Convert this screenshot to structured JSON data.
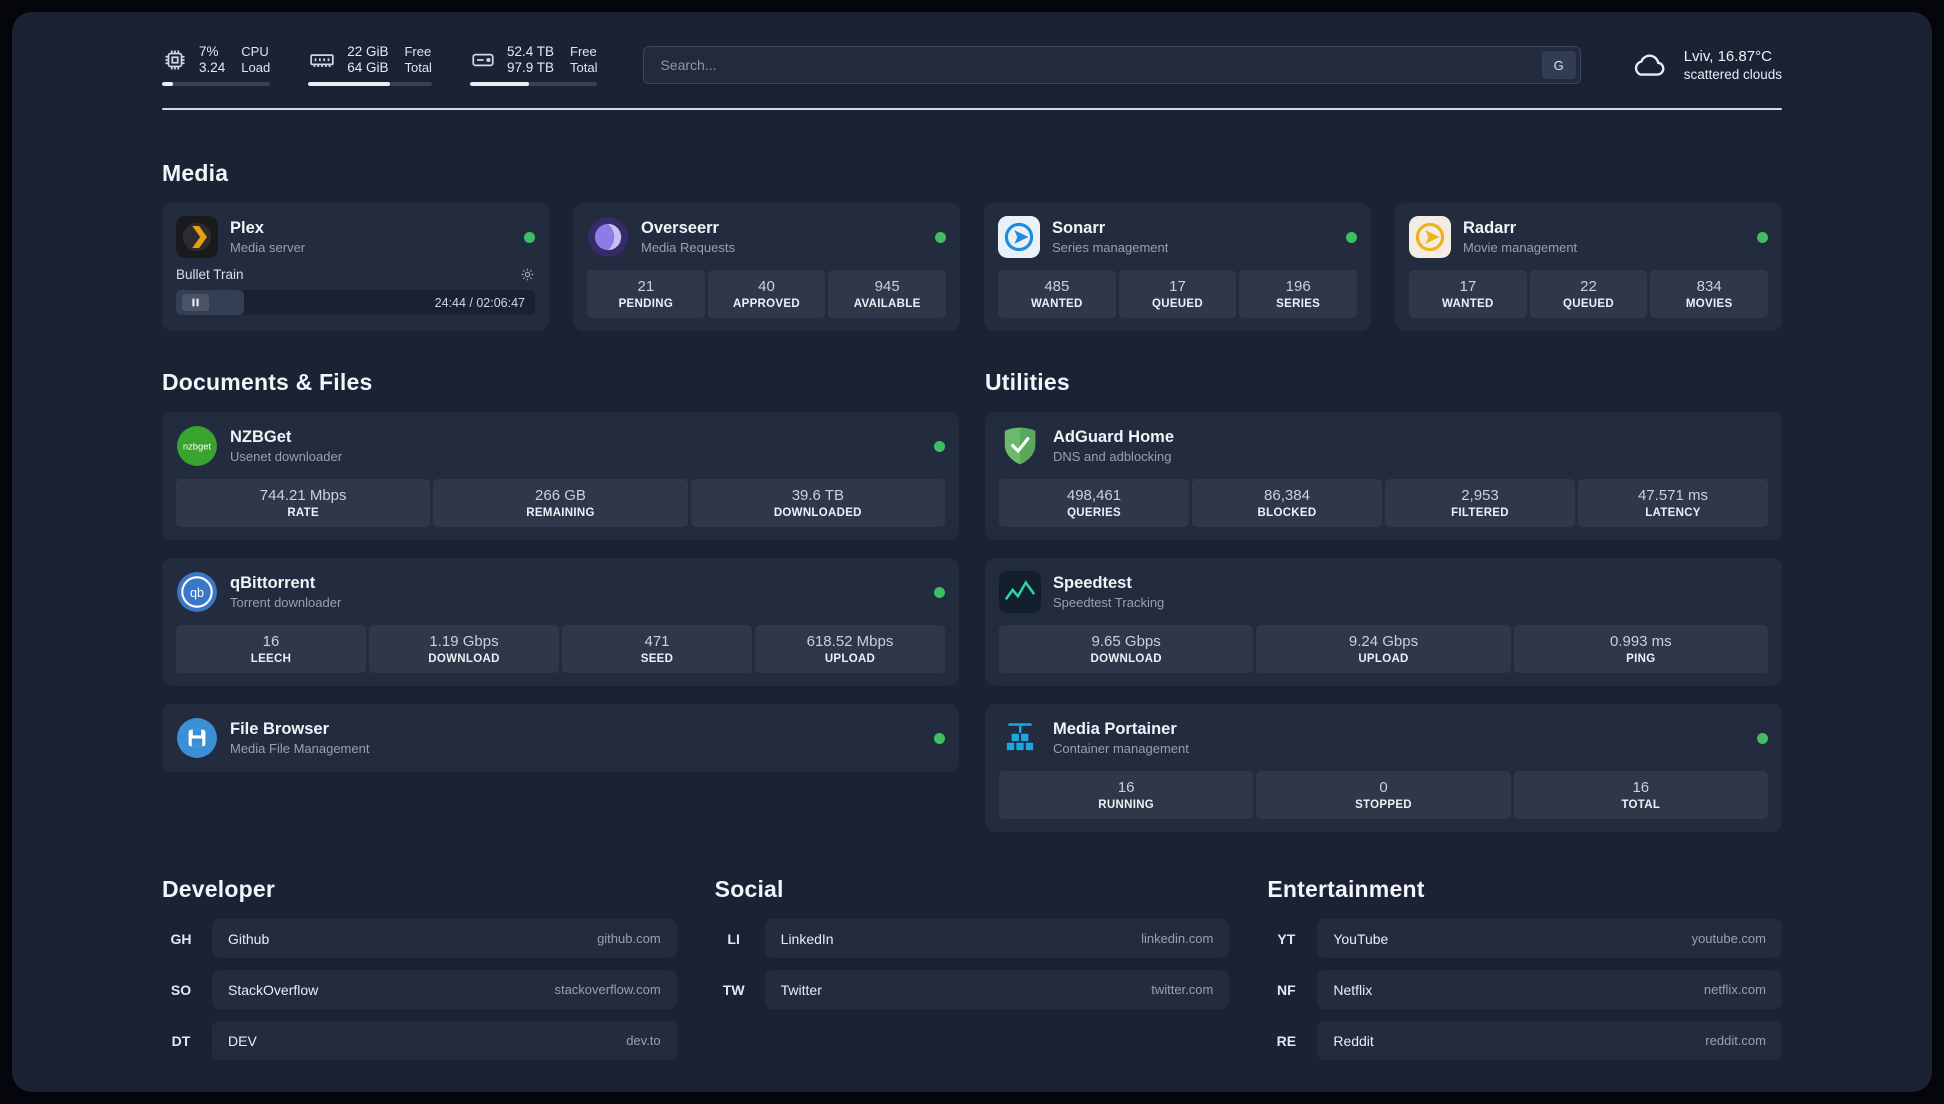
{
  "colors": {
    "status_green": "#3dbe63",
    "accent_bar": "#e9edf4"
  },
  "topbar": {
    "metrics": [
      {
        "id": "cpu",
        "icon": "cpu-icon",
        "v1": "7%",
        "l1": "CPU",
        "v2": "3.24",
        "l2": "Load",
        "progress": 10
      },
      {
        "id": "ram",
        "icon": "ram-icon",
        "v1": "22 GiB",
        "l1": "Free",
        "v2": "64 GiB",
        "l2": "Total",
        "progress": 66
      },
      {
        "id": "disk",
        "icon": "disk-icon",
        "v1": "52.4 TB",
        "l1": "Free",
        "v2": "97.9 TB",
        "l2": "Total",
        "progress": 46
      }
    ],
    "search": {
      "placeholder": "Search...",
      "button_label": "G"
    },
    "weather": {
      "icon": "cloud-icon",
      "location": "Lviv, 16.87°C",
      "condition": "scattered clouds"
    }
  },
  "sections": {
    "media": {
      "title": "Media",
      "apps": [
        {
          "name": "Plex",
          "subtitle": "Media server",
          "icon": "plex-icon",
          "online": true,
          "player": {
            "track": "Bullet Train",
            "time": "24:44 / 02:06:47",
            "progress": 19
          }
        },
        {
          "name": "Overseerr",
          "subtitle": "Media Requests",
          "icon": "overseerr-icon",
          "online": true,
          "stats": [
            {
              "value": "21",
              "label": "PENDING"
            },
            {
              "value": "40",
              "label": "APPROVED"
            },
            {
              "value": "945",
              "label": "AVAILABLE"
            }
          ]
        },
        {
          "name": "Sonarr",
          "subtitle": "Series management",
          "icon": "sonarr-icon",
          "online": true,
          "stats": [
            {
              "value": "485",
              "label": "WANTED"
            },
            {
              "value": "17",
              "label": "QUEUED"
            },
            {
              "value": "196",
              "label": "SERIES"
            }
          ]
        },
        {
          "name": "Radarr",
          "subtitle": "Movie management",
          "icon": "radarr-icon",
          "online": true,
          "stats": [
            {
              "value": "17",
              "label": "WANTED"
            },
            {
              "value": "22",
              "label": "QUEUED"
            },
            {
              "value": "834",
              "label": "MOVIES"
            }
          ]
        }
      ]
    },
    "documents": {
      "title": "Documents & Files",
      "apps": [
        {
          "name": "NZBGet",
          "subtitle": "Usenet downloader",
          "icon": "nzbget-icon",
          "online": true,
          "stats": [
            {
              "value": "744.21 Mbps",
              "label": "RATE"
            },
            {
              "value": "266 GB",
              "label": "REMAINING"
            },
            {
              "value": "39.6 TB",
              "label": "DOWNLOADED"
            }
          ]
        },
        {
          "name": "qBittorrent",
          "subtitle": "Torrent downloader",
          "icon": "qbittorrent-icon",
          "online": true,
          "stats": [
            {
              "value": "16",
              "label": "LEECH"
            },
            {
              "value": "1.19 Gbps",
              "label": "DOWNLOAD"
            },
            {
              "value": "471",
              "label": "SEED"
            },
            {
              "value": "618.52 Mbps",
              "label": "UPLOAD"
            }
          ]
        },
        {
          "name": "File Browser",
          "subtitle": "Media File Management",
          "icon": "filebrowser-icon",
          "online": true,
          "stats": []
        }
      ]
    },
    "utilities": {
      "title": "Utilities",
      "apps": [
        {
          "name": "AdGuard Home",
          "subtitle": "DNS and adblocking",
          "icon": "adguard-icon",
          "online": false,
          "stats": [
            {
              "value": "498,461",
              "label": "QUERIES"
            },
            {
              "value": "86,384",
              "label": "BLOCKED"
            },
            {
              "value": "2,953",
              "label": "FILTERED"
            },
            {
              "value": "47.571 ms",
              "label": "LATENCY"
            }
          ]
        },
        {
          "name": "Speedtest",
          "subtitle": "Speedtest Tracking",
          "icon": "speedtest-icon",
          "online": false,
          "stats": [
            {
              "value": "9.65 Gbps",
              "label": "DOWNLOAD"
            },
            {
              "value": "9.24 Gbps",
              "label": "UPLOAD"
            },
            {
              "value": "0.993 ms",
              "label": "PING"
            }
          ]
        },
        {
          "name": "Media Portainer",
          "subtitle": "Container management",
          "icon": "portainer-icon",
          "online": true,
          "stats": [
            {
              "value": "16",
              "label": "RUNNING"
            },
            {
              "value": "0",
              "label": "STOPPED"
            },
            {
              "value": "16",
              "label": "TOTAL"
            }
          ]
        }
      ]
    }
  },
  "bookmarks": [
    {
      "title": "Developer",
      "items": [
        {
          "abbr": "GH",
          "name": "Github",
          "url": "github.com"
        },
        {
          "abbr": "SO",
          "name": "StackOverflow",
          "url": "stackoverflow.com"
        },
        {
          "abbr": "DT",
          "name": "DEV",
          "url": "dev.to"
        }
      ]
    },
    {
      "title": "Social",
      "items": [
        {
          "abbr": "LI",
          "name": "LinkedIn",
          "url": "linkedin.com"
        },
        {
          "abbr": "TW",
          "name": "Twitter",
          "url": "twitter.com"
        }
      ]
    },
    {
      "title": "Entertainment",
      "items": [
        {
          "abbr": "YT",
          "name": "YouTube",
          "url": "youtube.com"
        },
        {
          "abbr": "NF",
          "name": "Netflix",
          "url": "netflix.com"
        },
        {
          "abbr": "RE",
          "name": "Reddit",
          "url": "reddit.com"
        }
      ]
    }
  ]
}
